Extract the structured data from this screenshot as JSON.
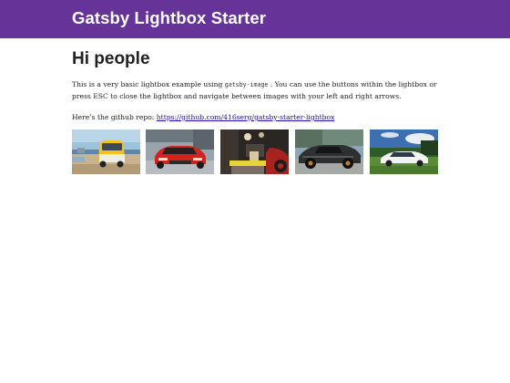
{
  "header": {
    "title": "Gatsby Lightbox Starter"
  },
  "main": {
    "heading": "Hi people",
    "intro_before": "This is a very basic lightbox example using ",
    "intro_code": "gatsby-image",
    "intro_after": " . You can use the buttons within the lightbox or press ESC to close the lightbox and navigate between images with your left and right arrows.",
    "repo_label": "Here’s the github repo: ",
    "repo_link": "https://github.com/416serg/gatsby-starter-lightbox"
  },
  "gallery": {
    "images": [
      {
        "name": "yellow-van-photo"
      },
      {
        "name": "red-sports-car-photo"
      },
      {
        "name": "garage-car-interior-photo"
      },
      {
        "name": "black-lamborghini-photo"
      },
      {
        "name": "white-tesla-photo"
      }
    ]
  },
  "colors": {
    "header_bg": "#663399",
    "link": "#1a0dab"
  }
}
